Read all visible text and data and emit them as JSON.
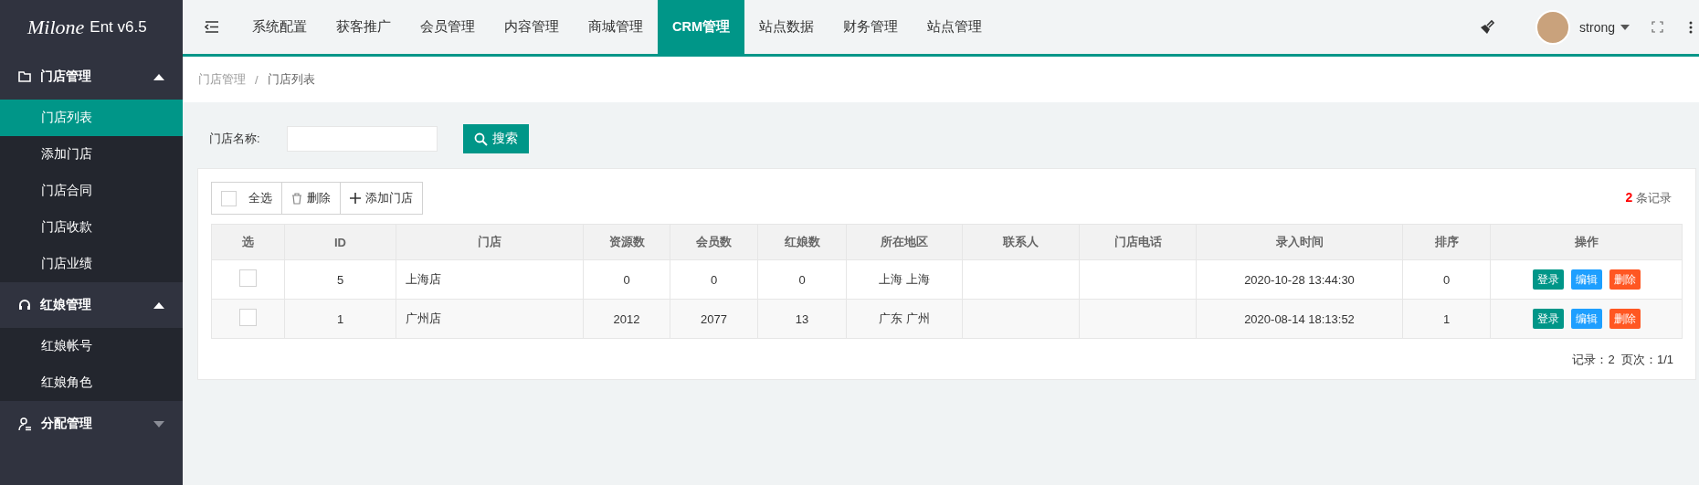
{
  "sidebar": {
    "logo_script": "Milone",
    "logo_text": "Ent v6.5",
    "groups": [
      {
        "label": "门店管理",
        "expanded": true,
        "children": [
          {
            "label": "门店列表",
            "selected": true
          },
          {
            "label": "添加门店",
            "selected": false
          },
          {
            "label": "门店合同",
            "selected": false
          },
          {
            "label": "门店收款",
            "selected": false
          },
          {
            "label": "门店业绩",
            "selected": false
          }
        ]
      },
      {
        "label": "红娘管理",
        "expanded": true,
        "children": [
          {
            "label": "红娘帐号",
            "selected": false
          },
          {
            "label": "红娘角色",
            "selected": false
          }
        ]
      },
      {
        "label": "分配管理",
        "expanded": false
      }
    ]
  },
  "top_nav": {
    "items": [
      {
        "label": "系统配置",
        "selected": false
      },
      {
        "label": "获客推广",
        "selected": false
      },
      {
        "label": "会员管理",
        "selected": false
      },
      {
        "label": "内容管理",
        "selected": false
      },
      {
        "label": "商城管理",
        "selected": false
      },
      {
        "label": "CRM管理",
        "selected": true
      },
      {
        "label": "站点数据",
        "selected": false
      },
      {
        "label": "财务管理",
        "selected": false
      },
      {
        "label": "站点管理",
        "selected": false
      }
    ],
    "username": "strong"
  },
  "breadcrumb": {
    "items": [
      "门店管理",
      "门店列表"
    ],
    "separator": "/"
  },
  "search": {
    "label": "门店名称:",
    "button": "搜索"
  },
  "toolbar": {
    "select_all": {
      "label": "全选",
      "checked": false
    },
    "delete": "删除",
    "add": "添加门店"
  },
  "record_count": {
    "count": "2",
    "label": "条记录"
  },
  "table": {
    "columns": [
      "选",
      "ID",
      "门店",
      "资源数",
      "会员数",
      "红娘数",
      "所在地区",
      "联系人",
      "门店电话",
      "录入时间",
      "排序",
      "操作"
    ],
    "rows": [
      {
        "checked": false,
        "cells": [
          "",
          "5",
          "上海店",
          "0",
          "0",
          "0",
          "上海 上海",
          "",
          "",
          "2020-10-28 13:44:30",
          "0"
        ],
        "actions": [
          {
            "label": "登录",
            "kind": "login"
          },
          {
            "label": "编辑",
            "kind": "edit"
          },
          {
            "label": "删除",
            "kind": "delete"
          }
        ]
      },
      {
        "checked": false,
        "cells": [
          "",
          "1",
          "广州店",
          "2012",
          "2077",
          "13",
          "广东 广州",
          "",
          "",
          "2020-08-14 18:13:52",
          "1"
        ],
        "actions": [
          {
            "label": "登录",
            "kind": "login"
          },
          {
            "label": "编辑",
            "kind": "edit"
          },
          {
            "label": "删除",
            "kind": "delete"
          }
        ]
      }
    ]
  },
  "pagination": "记录：2  页次：1/1"
}
